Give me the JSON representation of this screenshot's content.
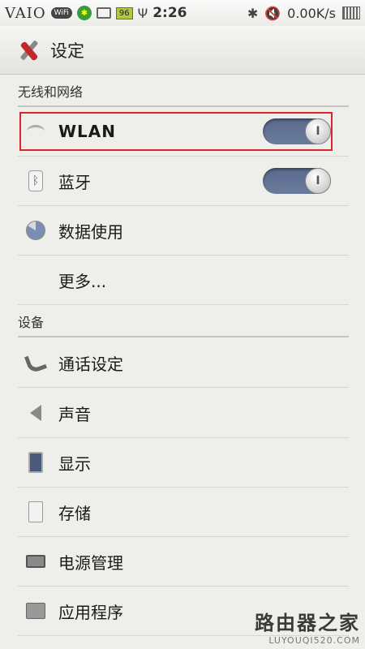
{
  "statusbar": {
    "brand": "VAIO",
    "wifi_badge": "WiFi",
    "battery_badge": "96",
    "time": "2:26",
    "network_speed": "0.00K/s"
  },
  "actionbar": {
    "title": "设定",
    "icon": "tools-icon"
  },
  "sections": {
    "wireless": {
      "header": "无线和网络",
      "items": [
        {
          "label": "WLAN",
          "icon": "wifi-icon",
          "toggle": true
        },
        {
          "label": "蓝牙",
          "icon": "bluetooth-icon",
          "toggle": true
        },
        {
          "label": "数据使用",
          "icon": "data-usage-icon"
        },
        {
          "label": "更多..."
        }
      ]
    },
    "device": {
      "header": "设备",
      "items": [
        {
          "label": "通话设定",
          "icon": "phone-icon"
        },
        {
          "label": "声音",
          "icon": "speaker-icon"
        },
        {
          "label": "显示",
          "icon": "display-icon"
        },
        {
          "label": "存储",
          "icon": "storage-icon"
        },
        {
          "label": "电源管理",
          "icon": "battery-icon"
        },
        {
          "label": "应用程序",
          "icon": "apps-icon"
        }
      ]
    }
  },
  "toggle_knob_mark": "I",
  "colors": {
    "toggle_on": "#5a6a8c",
    "highlight": "#d7262c",
    "background": "#eeeeea"
  },
  "watermark": {
    "text": "路由器之家",
    "url": "LUYOUQI520.COM"
  }
}
